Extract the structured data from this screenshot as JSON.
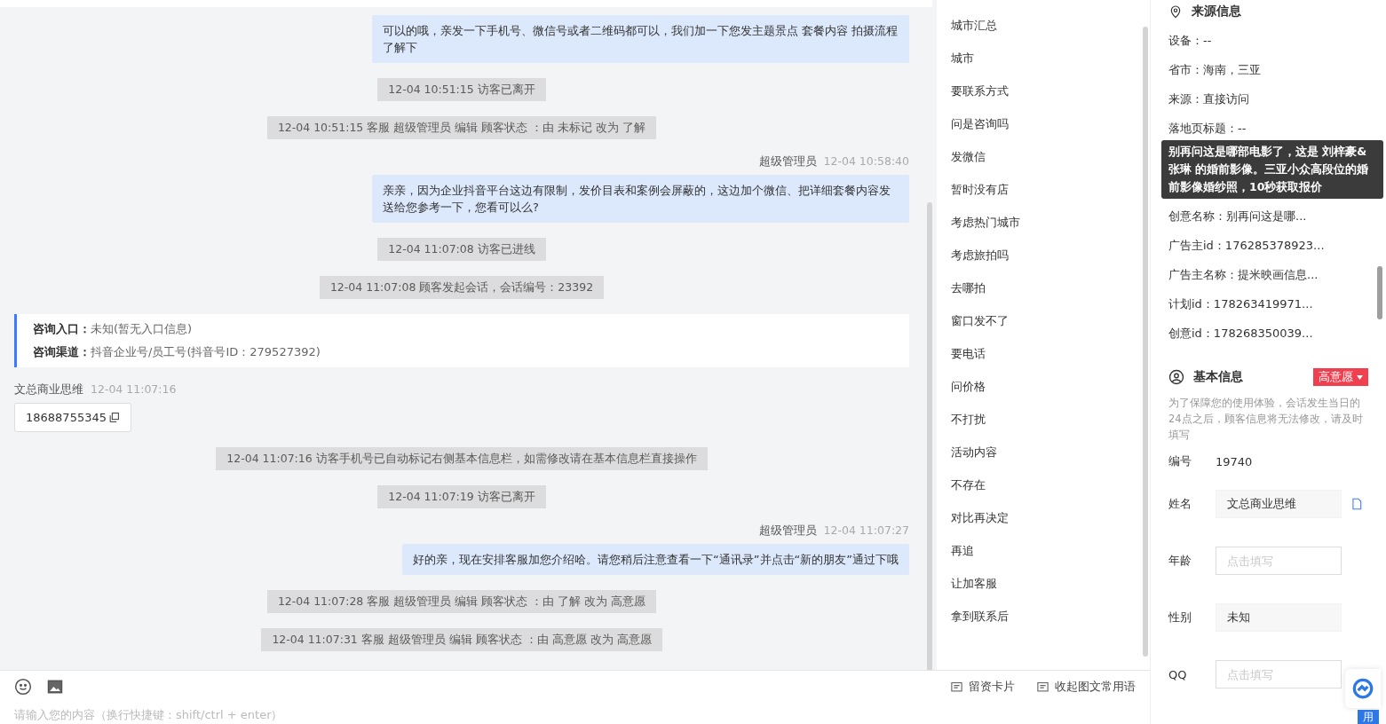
{
  "messages": [
    {
      "kind": "agent",
      "text": "可以的哦，亲发一下手机号、微信号或者二维码都可以，我们加一下您发主题景点 套餐内容 拍摄流程了解下"
    },
    {
      "kind": "system",
      "text": "12-04 10:51:15 访客已离开"
    },
    {
      "kind": "system",
      "text": "12-04 10:51:15 客服 超级管理员 编辑 顾客状态 ：由 未标记 改为 了解"
    },
    {
      "kind": "agent",
      "sender": "超级管理员",
      "time": "12-04 10:58:40",
      "text": "亲亲，因为企业抖音平台这边有限制，发价目表和案例会屏蔽的，这边加个微信、把详细套餐内容发送给您参考一下，您看可以么?"
    },
    {
      "kind": "system",
      "text": "12-04 11:07:08 访客已进线"
    },
    {
      "kind": "system",
      "text": "12-04 11:07:08 顾客发起会话，会话编号：23392"
    },
    {
      "kind": "info",
      "rows": [
        {
          "label": "咨询入口：",
          "value": "未知(暂无入口信息)"
        },
        {
          "label": "咨询渠道：",
          "value": "抖音企业号/员工号(抖音号ID：279527392)"
        }
      ]
    },
    {
      "kind": "visitor",
      "sender": "文总商业思维",
      "time": "12-04 11:07:16",
      "text": "18688755345"
    },
    {
      "kind": "system",
      "text": "12-04 11:07:16 访客手机号已自动标记右侧基本信息栏，如需修改请在基本信息栏直接操作"
    },
    {
      "kind": "system",
      "text": "12-04 11:07:19 访客已离开"
    },
    {
      "kind": "agent",
      "sender": "超级管理员",
      "time": "12-04 11:07:27",
      "text": "好的亲，现在安排客服加您介绍哈。请您稍后注意查看一下“通讯录”并点击“新的朋友”通过下哦"
    },
    {
      "kind": "system",
      "text": "12-04 11:07:28 客服 超级管理员 编辑 顾客状态 ：由 了解 改为 高意愿"
    },
    {
      "kind": "system",
      "text": "12-04 11:07:31 客服 超级管理员 编辑 顾客状态 ：由 高意愿 改为 高意愿"
    }
  ],
  "input": {
    "placeholder": "请输入您的内容（换行快捷键：shift/ctrl + enter）"
  },
  "quick_replies": [
    "城市汇总",
    "城市",
    "要联系方式",
    "问是咨询吗",
    "发微信",
    "暂时没有店",
    "考虑热门城市",
    "考虑旅拍吗",
    "去哪拍",
    "窗口发不了",
    "要电话",
    "问价格",
    "不打扰",
    "活动内容",
    "不存在",
    "对比再决定",
    "再追",
    "让加客服",
    "拿到联系后"
  ],
  "toolbar_buttons": [
    "留资卡片",
    "收起图文常用语"
  ],
  "source_info": {
    "title": "来源信息",
    "rows": [
      "设备：--",
      "省市：海南，三亚",
      "来源：直接访问",
      "落地页标题：--"
    ],
    "rows_after": [
      "创意名称：别再问这是哪...",
      "广告主id：176285378923...",
      "广告主名称：提米映画信息...",
      "计划id：178263419971...",
      "创意id：178268350039..."
    ],
    "tooltip": "别再问这是哪部电影了，这是 刘梓豪&张琳 的婚前影像。三亚小众高段位的婚前影像婚纱照，10秒获取报价"
  },
  "basic_info": {
    "title": "基本信息",
    "status": "高意愿",
    "notice": "为了保障您的使用体验，会话发生当日的24点之后，顾客信息将无法修改，请及时填写",
    "fields": [
      {
        "kind": "static",
        "label": "编号",
        "value": "19740"
      },
      {
        "kind": "readonly",
        "label": "姓名",
        "value": "文总商业思维"
      },
      {
        "kind": "input",
        "label": "年龄",
        "placeholder": "点击填写"
      },
      {
        "kind": "readonly",
        "label": "性别",
        "value": "未知"
      },
      {
        "kind": "input",
        "label": "QQ",
        "placeholder": "点击填写"
      }
    ]
  },
  "float_button": "用"
}
